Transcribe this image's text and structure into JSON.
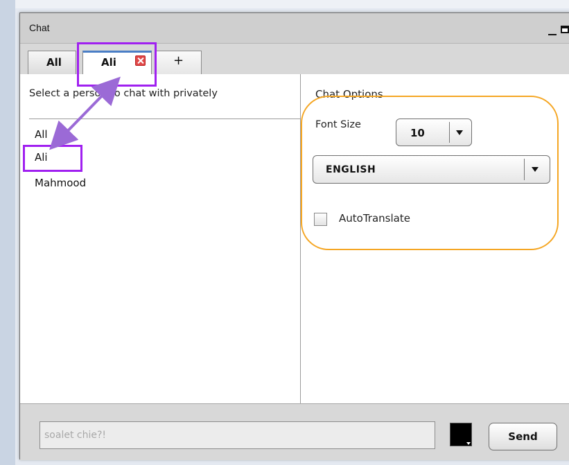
{
  "window": {
    "title": "Chat"
  },
  "tabs": [
    {
      "label": "All"
    },
    {
      "label": "Ali"
    },
    {
      "label": "+"
    }
  ],
  "left_panel": {
    "header": "Select a person to chat with privately",
    "people": [
      "All",
      "Ali",
      "Mahmood"
    ]
  },
  "chat_options": {
    "title": "Chat Options",
    "font_size_label": "Font Size",
    "font_size_value": "10",
    "language_value": "ENGLISH",
    "autotranslate_label": "AutoTranslate",
    "autotranslate_checked": false
  },
  "footer": {
    "message_value": "soalet chie?!",
    "send_label": "Send",
    "text_color": "#000000"
  },
  "annotation_colors": {
    "highlight_purple": "#a020f0",
    "highlight_orange": "#f5a623",
    "arrow_purple": "#9b6ad6"
  },
  "icons": [
    "close-icon",
    "minimize-icon",
    "maximize-icon",
    "chevron-down-icon"
  ]
}
